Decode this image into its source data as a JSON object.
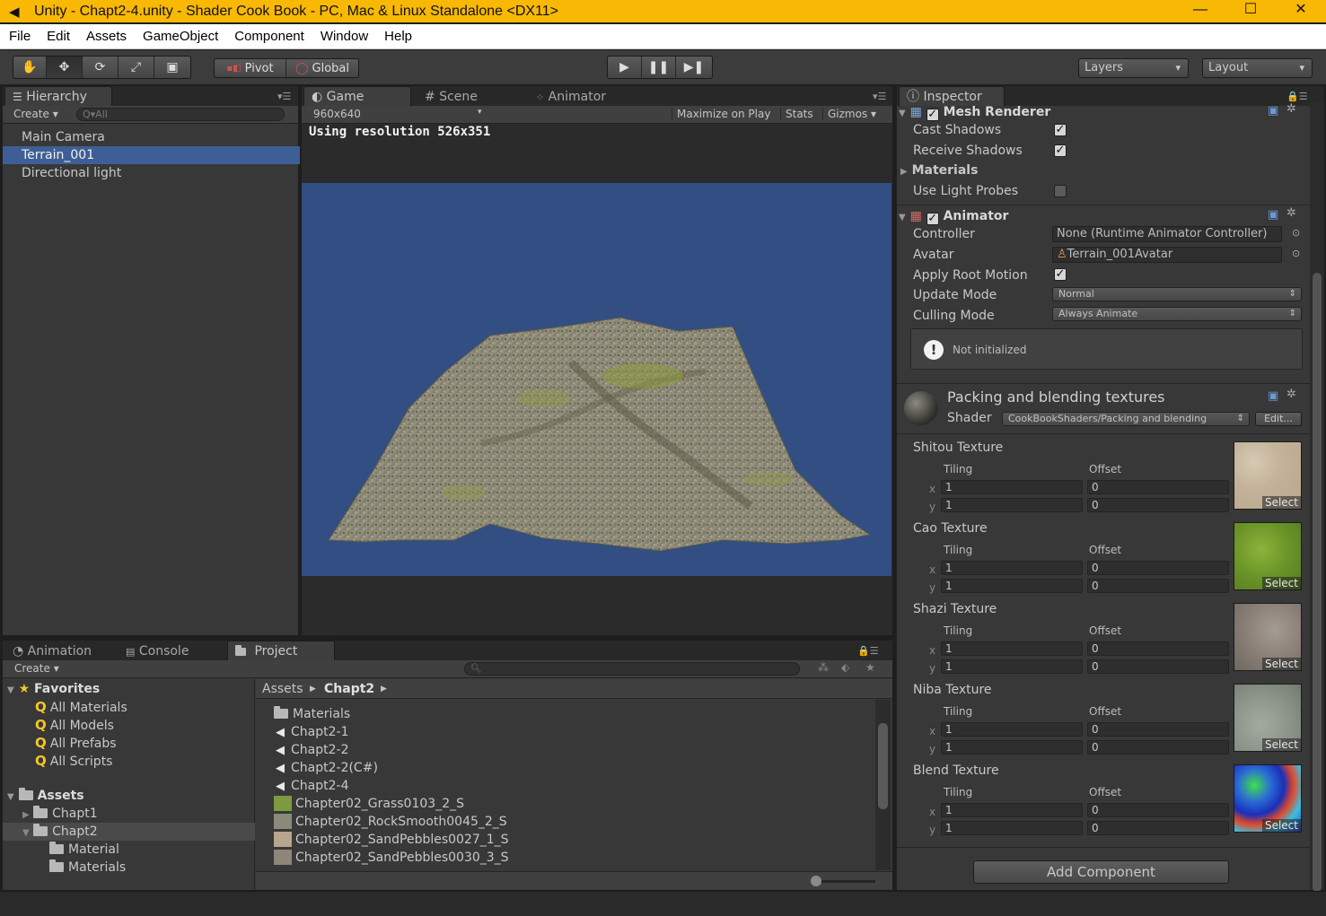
{
  "window": {
    "title": "Unity - Chapt2-4.unity - Shader Cook Book - PC, Mac & Linux Standalone <DX11>",
    "minimize": "—",
    "maximize": "☐",
    "close": "✕"
  },
  "menu": [
    "File",
    "Edit",
    "Assets",
    "GameObject",
    "Component",
    "Window",
    "Help"
  ],
  "toolbar": {
    "tools": [
      "hand",
      "move",
      "rotate",
      "scale",
      "rect"
    ],
    "pivot_label": "Pivot",
    "global_label": "Global",
    "layers_label": "Layers",
    "layout_label": "Layout"
  },
  "hierarchy": {
    "tab": "Hierarchy",
    "create": "Create",
    "search_placeholder": "Q▾All",
    "items": [
      {
        "label": "Main Camera",
        "selected": false
      },
      {
        "label": "Terrain_001",
        "selected": true
      },
      {
        "label": "Directional light",
        "selected": false
      }
    ]
  },
  "game": {
    "tabs": [
      "Game",
      "Scene",
      "Animator"
    ],
    "resolution": "960x640",
    "maximize_on_play": "Maximize on Play",
    "stats": "Stats",
    "gizmos": "Gizmos",
    "using_resolution": "Using resolution 526x351",
    "background_color": "#324e82"
  },
  "bottom": {
    "tabs": [
      "Animation",
      "Console",
      "Project"
    ],
    "create": "Create",
    "favorites_label": "Favorites",
    "favorites": [
      "All Materials",
      "All Models",
      "All Prefabs",
      "All Scripts"
    ],
    "assets_label": "Assets",
    "asset_folders": [
      "Chapt1",
      "Chapt2",
      "Material",
      "Materials"
    ],
    "breadcrumb_root": "Assets",
    "breadcrumb_current": "Chapt2",
    "files": [
      {
        "label": "Materials",
        "kind": "folder"
      },
      {
        "label": "Chapt2-1",
        "kind": "scene"
      },
      {
        "label": "Chapt2-2",
        "kind": "scene"
      },
      {
        "label": "Chapt2-2(C#)",
        "kind": "scene"
      },
      {
        "label": "Chapt2-4",
        "kind": "scene"
      },
      {
        "label": "Chapter02_Grass0103_2_S",
        "kind": "texture",
        "color": "#7d9a3e"
      },
      {
        "label": "Chapter02_RockSmooth0045_2_S",
        "kind": "texture",
        "color": "#8a8a7c"
      },
      {
        "label": "Chapter02_SandPebbles0027_1_S",
        "kind": "texture",
        "color": "#b7a58e"
      },
      {
        "label": "Chapter02_SandPebbles0030_3_S",
        "kind": "texture",
        "color": "#8f8578"
      }
    ]
  },
  "inspector": {
    "tab": "Inspector",
    "mesh_renderer": {
      "title": "Mesh Renderer",
      "cast_shadows": "Cast Shadows",
      "receive_shadows": "Receive Shadows",
      "materials": "Materials",
      "use_light_probes": "Use Light Probes"
    },
    "animator": {
      "title": "Animator",
      "controller_label": "Controller",
      "controller_value": "None (Runtime Animator Controller)",
      "avatar_label": "Avatar",
      "avatar_value": "Terrain_001Avatar",
      "apply_root_motion": "Apply Root Motion",
      "update_mode_label": "Update Mode",
      "update_mode_value": "Normal",
      "culling_mode_label": "Culling Mode",
      "culling_mode_value": "Always Animate",
      "warning": "Not initialized"
    },
    "material": {
      "name": "Packing and blending textures",
      "shader_label": "Shader",
      "shader_value": "CookBookShaders/Packing and blending",
      "edit": "Edit..."
    },
    "tiling_label": "Tiling",
    "offset_label": "Offset",
    "select_label": "Select",
    "textures": [
      {
        "label": "Shitou Texture",
        "tiling_x": "1",
        "tiling_y": "1",
        "offset_x": "0",
        "offset_y": "0",
        "color": "#c9b8a0"
      },
      {
        "label": "Cao Texture",
        "tiling_x": "1",
        "tiling_y": "1",
        "offset_x": "0",
        "offset_y": "0",
        "color": "#6e9a2c"
      },
      {
        "label": "Shazi Texture",
        "tiling_x": "1",
        "tiling_y": "1",
        "offset_x": "0",
        "offset_y": "0",
        "color": "#8e8680"
      },
      {
        "label": "Niba Texture",
        "tiling_x": "1",
        "tiling_y": "1",
        "offset_x": "0",
        "offset_y": "0",
        "color": "#8d958a"
      },
      {
        "label": "Blend Texture",
        "tiling_x": "1",
        "tiling_y": "1",
        "offset_x": "0",
        "offset_y": "0",
        "color": "#2a6bd6"
      }
    ],
    "add_component": "Add Component"
  }
}
